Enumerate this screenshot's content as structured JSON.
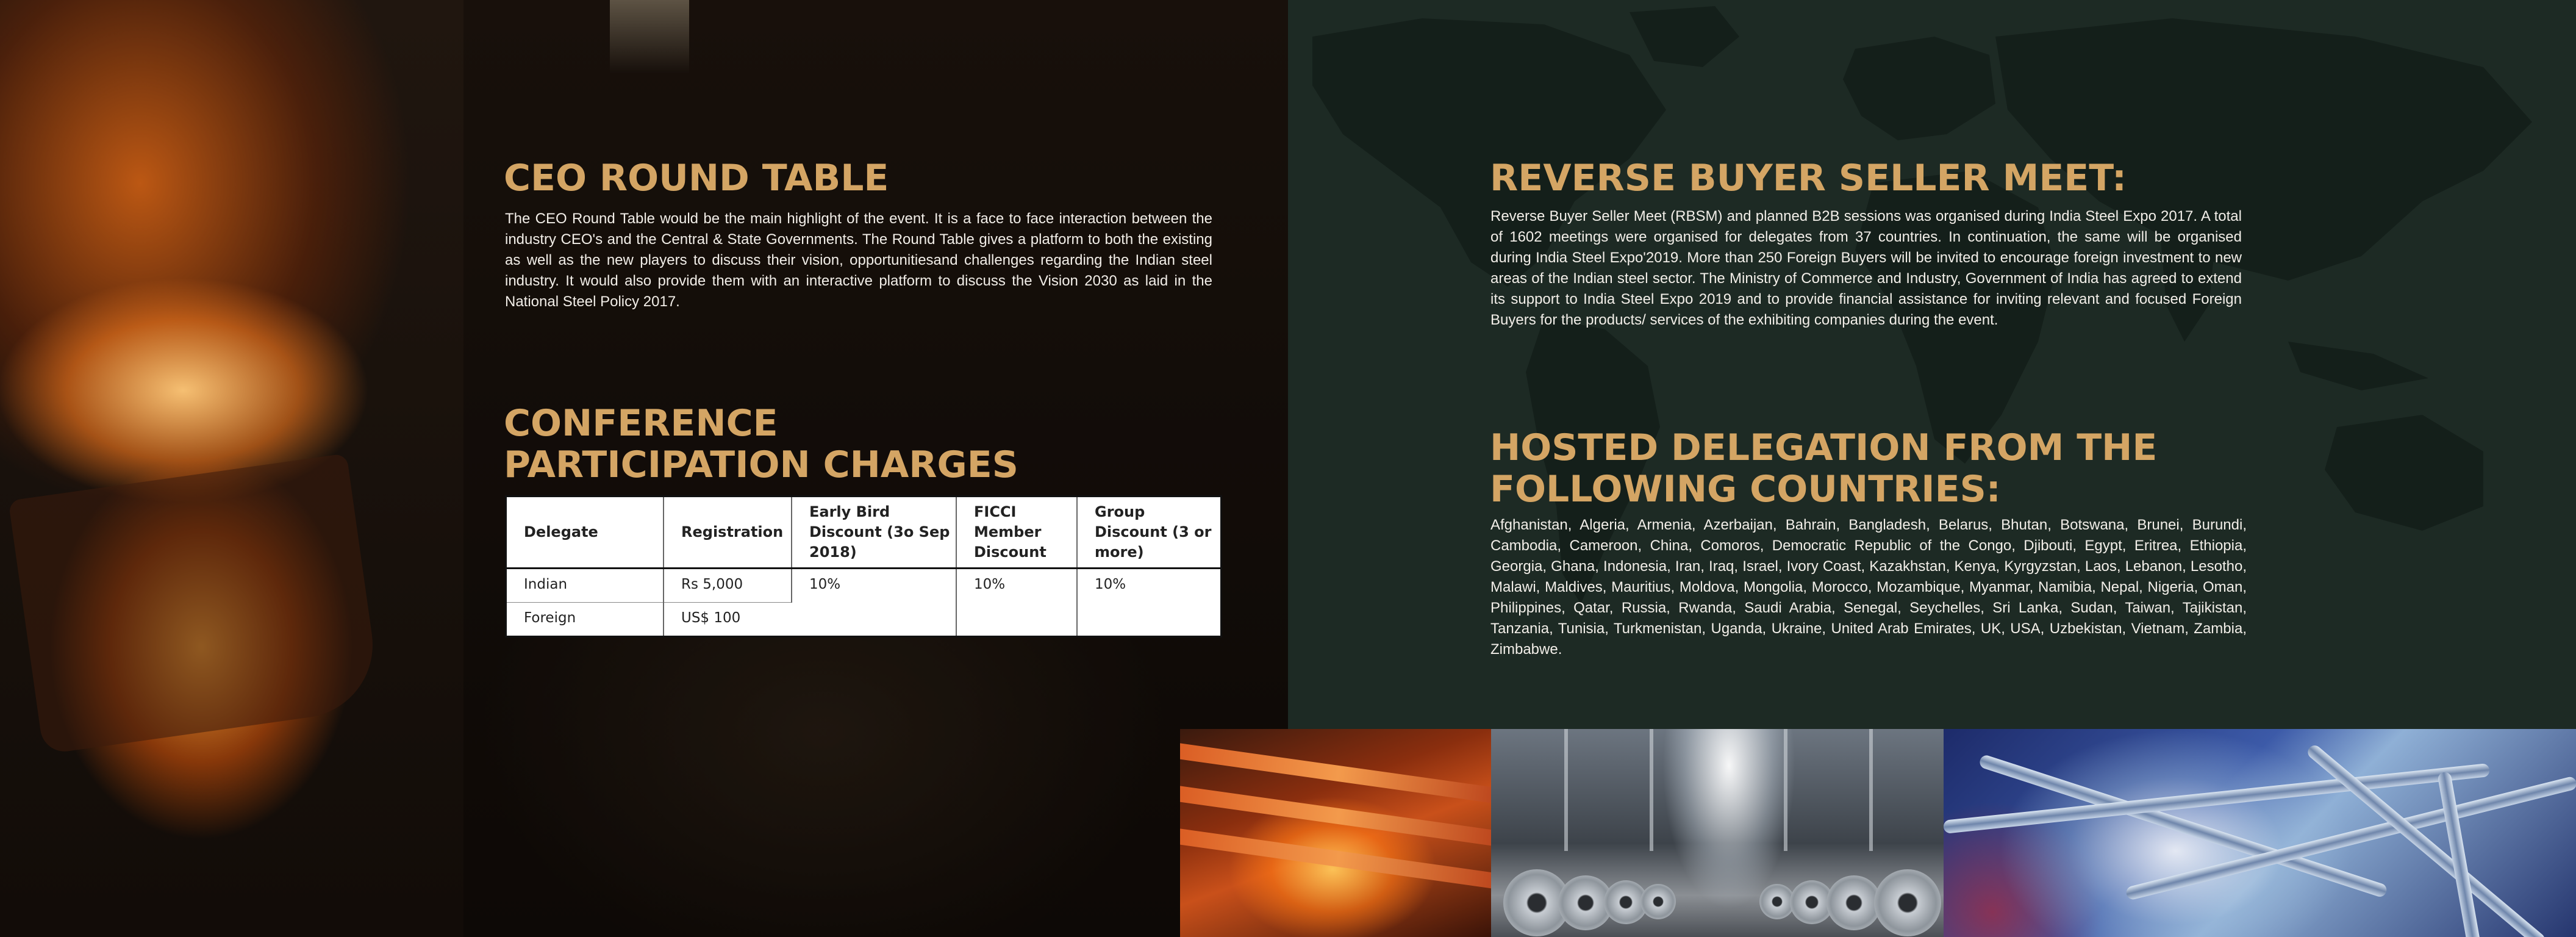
{
  "ceo": {
    "title": "CEO ROUND TABLE",
    "text": "The CEO Round Table would be the main highlight of the event. It is a face to face interaction between the industry CEO's and the Central & State Governments. The Round Table gives a platform to both the existing as well as the new players to discuss their vision, opportunitiesand challenges regarding the Indian steel industry. It would also provide them with an interactive platform to discuss the Vision 2030 as laid in the National Steel Policy 2017."
  },
  "conference": {
    "title_line1": "CONFERENCE",
    "title_line2": "PARTICIPATION CHARGES",
    "table": {
      "headers": [
        "Delegate",
        "Registration",
        "Early Bird Discount (3o Sep 2018)",
        "FICCI Member Discount",
        "Group Discount (3 or more)"
      ],
      "rows": [
        [
          "Indian",
          "Rs 5,000",
          "10%",
          "10%",
          "10%"
        ],
        [
          "Foreign",
          "US$ 100",
          "",
          "",
          ""
        ]
      ]
    }
  },
  "rbsm": {
    "title": "REVERSE BUYER SELLER MEET:",
    "text": "Reverse Buyer Seller Meet (RBSM) and planned B2B sessions was organised during India Steel Expo 2017. A total of 1602 meetings were organised for delegates from 37 countries. In continuation, the same will be organised during India Steel Expo'2019. More than 250 Foreign Buyers will be invited to encourage foreign investment to new areas of the Indian steel sector.  The Ministry of Commerce and Industry, Government of India has agreed to extend its support to India Steel Expo 2019 and to provide financial assistance for inviting relevant and focused Foreign Buyers for the products/ services of the exhibiting companies during the event."
  },
  "hosted": {
    "title_line1": "HOSTED DELEGATION FROM THE",
    "title_line2": "FOLLOWING COUNTRIES:",
    "text": "Afghanistan, Algeria, Armenia, Azerbaijan, Bahrain, Bangladesh, Belarus, Bhutan, Botswana, Brunei, Burundi, Cambodia, Cameroon, China, Comoros, Democratic Republic of the Congo, Djibouti, Egypt, Eritrea, Ethiopia, Georgia, Ghana, Indonesia, Iran, Iraq, Israel, Ivory Coast, Kazakhstan, Kenya, Kyrgyzstan, Laos, Lebanon, Lesotho, Malawi, Maldives, Mauritius, Moldova, Mongolia, Morocco, Mozambique, Myanmar, Namibia, Nepal, Nigeria, Oman, Philippines, Qatar, Russia, Rwanda, Saudi Arabia, Senegal, Seychelles, Sri Lanka, Sudan, Taiwan, Tajikistan, Tanzania, Tunisia, Turkmenistan, Uganda, Ukraine, United Arab Emirates, UK, USA, Uzbekistan, Vietnam, Zambia, Zimbabwe."
  },
  "colors": {
    "heading": "#d4a564",
    "map_background": "#1d2a24",
    "body_text": "#f2eee8"
  }
}
